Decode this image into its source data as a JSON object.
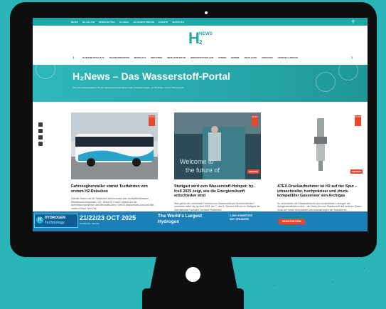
{
  "topnav": {
    "items": [
      "NEWS",
      "H2-ON-AIR",
      "NEWSLETTER",
      "GLOBAL",
      "H2-MARKTPREISE",
      "EVENTS",
      "SERVICES"
    ]
  },
  "logo": {
    "h": "H",
    "two": "2",
    "news": "NEWS"
  },
  "catnav": {
    "items": [
      "KLIMANEUTRALITÄT",
      "TRANSFORMATION",
      "MOBILITÄT",
      "INDUSTRIE",
      "INFRASTRUKTUR",
      "BRENNSTOFFZELLEN",
      "STROM",
      "WÄRME",
      "NEUE GASE",
      "SPEICHER",
      "HERSTELLUNGSVE"
    ]
  },
  "hero": {
    "title": "H₂News – Das Wasserstoff-Portal",
    "subtitle": "Ihre Informationsplattform für den Wasserstoff-Geschäfte in allen Industriezweigen, im Mobilitäts- und im Wärmemarkt."
  },
  "articles": [
    {
      "title": "Fahrzeughersteller startet Testfahrten von erstem H2-Reisebus",
      "text": "Daimler Buses hat mit Testfahrten seines ersten was-serstoffbetriebenen Reisebusses begonnen. Der „Setra H2 Coach“ basiert auf der Antriebskomponenten des Mercedes-Benz GenH2 Wasserstoff-Lkws und Mer-cedes-eCitaro Fuel Cell.",
      "badge": "18 OKT"
    },
    {
      "title": "Stuttgart wird zum Wasserstoff-Hotspot: hy-fcell 2025 zeigt, wie die Energiezukunft entschieden wird",
      "text": "Was gehört der industrielle Hochlauf von Wasserstoff und Brennstoffzellen? Antworten liefert die hy-fcell 2025. Am 7. und 8. Oktober trifft sich in Stuttgart die internationale Fachwelt, um über Produktion,",
      "tag": "ANZEIGE",
      "badge": "18 OKT"
    },
    {
      "title": "ATEX-Druckaufnehmer ist H2 auf der Spur – ultraschneller, hochpräziser und druck-kompatibler Gassensor von Archigas",
      "text": "Zu verschieden die Einsatzbereiche und konstruktiven Lösungen der Anlagenkonstruktion sind – die Detek-tion von Wasserstoff und anderen Gasen muss der hohen Ansprüchen und Anforderungen der Industrie ex-",
      "tag": "ANZEIGE",
      "badge": "18 OKT"
    }
  ],
  "banner": {
    "logo_top": "HYDROGEN",
    "logo_bottom": "Technology",
    "date": "21/22/23 OCT 2025",
    "location": "HAMBURG, MESSE",
    "world": "The World's Largest Hydrogen",
    "stats_top": "1,000+ EXHIBITORS",
    "stats_bottom": "300+ SPEAKERS",
    "cta": "REGISTER NOW"
  }
}
